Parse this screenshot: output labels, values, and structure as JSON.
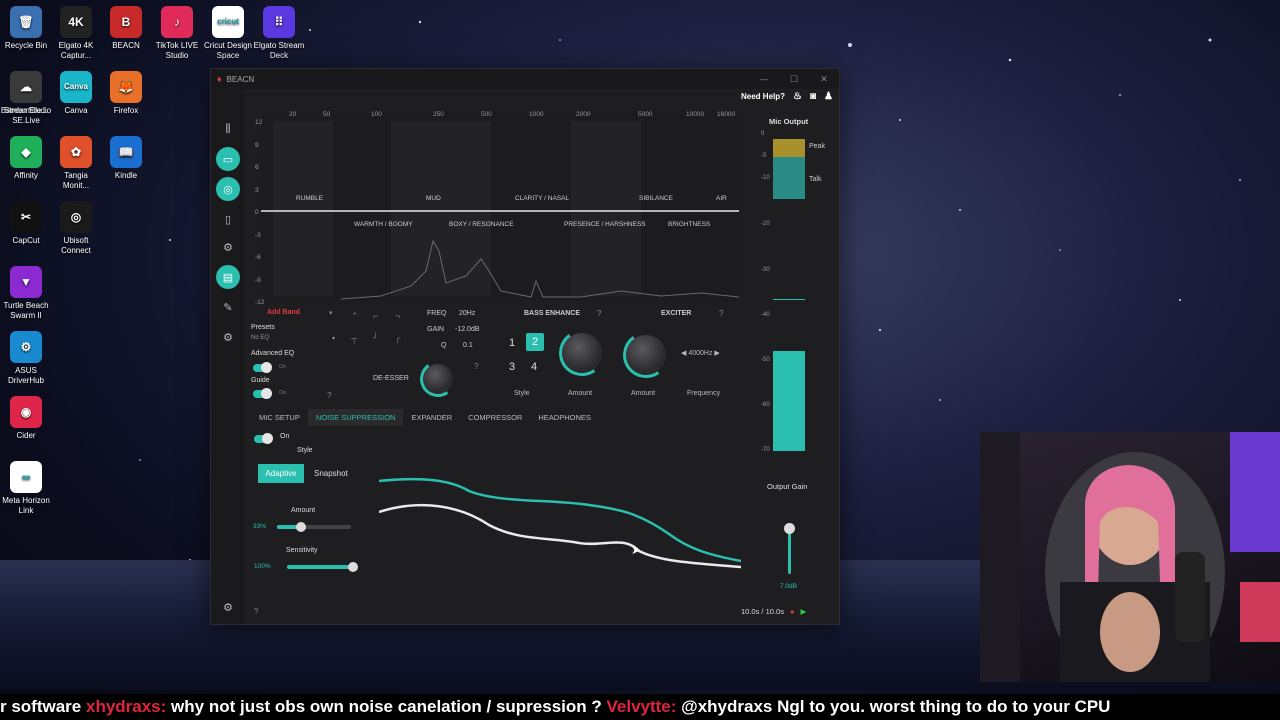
{
  "desktop": {
    "icons": [
      {
        "label": "Recycle Bin",
        "icon": "recycle-bin-icon",
        "color": "#3a6fb0",
        "glyph": "🗑"
      },
      {
        "label": "Elgato 4K Captur...",
        "icon": "elgato-4k-icon",
        "color": "#222222",
        "glyph": "4K"
      },
      {
        "label": "BEACN",
        "icon": "beacn-icon",
        "color": "#c82a2a",
        "glyph": "B"
      },
      {
        "label": "TikTok LIVE Studio",
        "icon": "tiktok-icon",
        "color": "#e02a5a",
        "glyph": "♪"
      },
      {
        "label": "Cricut Design Space",
        "icon": "cricut-icon",
        "color": "#ffffff",
        "glyph": "cricut"
      },
      {
        "label": "Elgato Stream Deck",
        "icon": "stream-deck-icon",
        "color": "#5a3ae0",
        "glyph": "⠿"
      },
      {
        "label": "Bambu Studio",
        "icon": "bambu-icon",
        "color": "#2ab04a",
        "glyph": "▙"
      },
      {
        "label": "Canva",
        "icon": "canva-icon",
        "color": "#19b5c8",
        "glyph": "Canva"
      },
      {
        "label": "Firefox",
        "icon": "firefox-icon",
        "color": "#e8702a",
        "glyph": "🦊"
      },
      {
        "label": "StreamEle... SE.Live",
        "icon": "streamelements-icon",
        "color": "#3a3a3a",
        "glyph": "☁"
      },
      {
        "label": "Affinity",
        "icon": "affinity-icon",
        "color": "#1fae5a",
        "glyph": "◆"
      },
      {
        "label": "Tangia Monit...",
        "icon": "tangia-icon",
        "color": "#e0502a",
        "glyph": "✿"
      },
      {
        "label": "Kindle",
        "icon": "kindle-icon",
        "color": "#1a6fd0",
        "glyph": "📖"
      },
      {
        "label": "CapCut",
        "icon": "capcut-icon",
        "color": "#111111",
        "glyph": "✂"
      },
      {
        "label": "Ubisoft Connect",
        "icon": "ubisoft-icon",
        "color": "#1a1a1a",
        "glyph": "◎"
      },
      {
        "label": "Turtle Beach Swarm II",
        "icon": "turtle-beach-icon",
        "color": "#8a2ad0",
        "glyph": "▼"
      },
      {
        "label": "ASUS DriverHub",
        "icon": "asus-icon",
        "color": "#1a8ad0",
        "glyph": "⚙"
      },
      {
        "label": "Cider",
        "icon": "cider-icon",
        "color": "#e0254a",
        "glyph": "◉"
      },
      {
        "label": "Meta Horizon Link",
        "icon": "meta-icon",
        "color": "#ffffff",
        "glyph": "∞"
      }
    ]
  },
  "window": {
    "title": "BEACN",
    "need_help": "Need Help?"
  },
  "eq": {
    "freq_ticks": [
      "20",
      "50",
      "100",
      "250",
      "500",
      "1000",
      "2000",
      "5000",
      "10000",
      "16000"
    ],
    "db_ticks": [
      "12",
      "9",
      "6",
      "3",
      "0",
      "-3",
      "-6",
      "-9",
      "-12"
    ],
    "upper_bands": [
      "RUMBLE",
      "MUD",
      "CLARITY / NASAL",
      "SIBILANCE",
      "AIR"
    ],
    "lower_bands": [
      "WARMTH / BOOMY",
      "BOXY / RESONANCE",
      "PRESENCE / HARSHNESS",
      "BRIGHTNESS"
    ]
  },
  "controls": {
    "add_band": "Add Band",
    "presets_label": "Presets",
    "presets_value": "No EQ",
    "advanced_eq": "Advanced EQ",
    "advanced_eq_state": "On",
    "guide": "Guide",
    "guide_state": "On",
    "freq_label": "FREQ",
    "freq_value": "20Hz",
    "gain_label": "GAIN",
    "gain_value": "-12.0dB",
    "q_label": "Q",
    "q_value": "0.1",
    "de_esser": "DE-ESSER",
    "bass_enhance": "BASS ENHANCE",
    "style_buttons": [
      "1",
      "2",
      "3",
      "4"
    ],
    "style_selected": "2",
    "style_label": "Style",
    "amount_label": "Amount",
    "exciter": "EXCITER",
    "exciter_freq": "4000Hz",
    "frequency_label": "Frequency"
  },
  "tabs": [
    "MIC SETUP",
    "NOISE SUPPRESSION",
    "EXPANDER",
    "COMPRESSOR",
    "HEADPHONES"
  ],
  "noise": {
    "state": "On",
    "style_label": "Style",
    "adaptive": "Adaptive",
    "snapshot": "Snapshot",
    "amount_label": "Amount",
    "amount_value": "33%",
    "amount_level": 0.33,
    "sensitivity_label": "Sensitivity",
    "sensitivity_value": "100%",
    "sensitivity_level": 1.0
  },
  "meter": {
    "title": "Mic Output",
    "scale": [
      "0",
      "-5",
      "-10",
      "-20",
      "-30",
      "-40",
      "-50",
      "-60",
      "-70"
    ],
    "peak_label": "Peak",
    "talk_label": "Talk",
    "output_gain_label": "Output Gain",
    "output_gain_value": "7.0dB",
    "time": "10.0s / 10.0s"
  },
  "ticker": {
    "text1": "r software ",
    "name1": "xhydraxs:",
    "text2": " why not just obs own noise canelation / supression ? ",
    "name2": "Velvytte:",
    "text3": " @xhydraxs Ngl to you. worst thing to do to your CPU"
  },
  "colors": {
    "accent": "#2bbfb0",
    "peak": "#a8902a",
    "talk": "#2a8a84",
    "add_band": "#e03a3a"
  }
}
